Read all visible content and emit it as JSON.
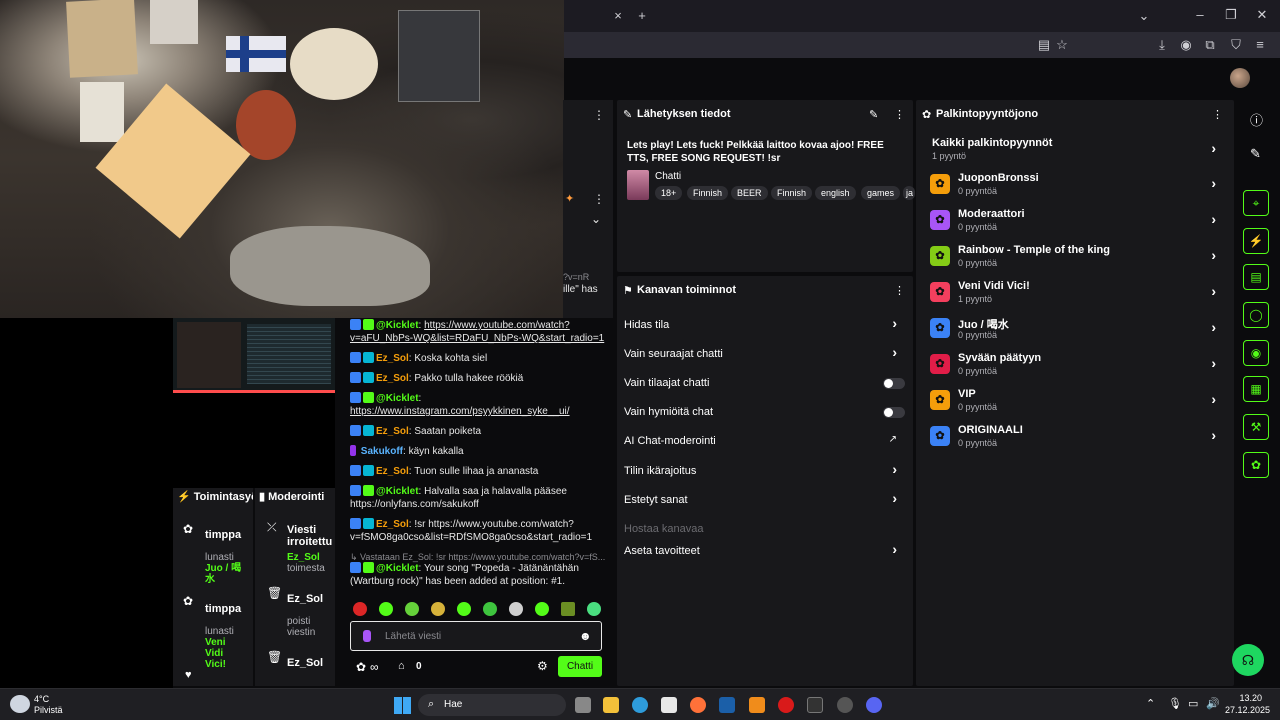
{
  "browser": {
    "tab_close": "×",
    "tab_new": "+"
  },
  "broadcast": {
    "header": "Lähetyksen tiedot",
    "title": "Lets play! Lets fuck! Pelkkää laittoo kovaa ajoo! FREE TTS, FREE SONG REQUEST! !sr",
    "category": "Chatti",
    "tags": [
      "18+",
      "Finnish",
      "BEER",
      "Finnish",
      "english",
      "games",
      "ja"
    ]
  },
  "channel_actions": {
    "header": "Kanavan toiminnot",
    "items": [
      {
        "label": "Hidas tila",
        "control": "chevron"
      },
      {
        "label": "Vain seuraajat chatti",
        "control": "chevron"
      },
      {
        "label": "Vain tilaajat chatti",
        "control": "toggle"
      },
      {
        "label": "Vain hymiöitä chat",
        "control": "toggle"
      },
      {
        "label": "AI Chat-moderointi",
        "control": "external"
      },
      {
        "label": "Tilin ikärajoitus",
        "control": "chevron"
      },
      {
        "label": "Estetyt sanat",
        "control": "chevron"
      },
      {
        "label": "Hostaa kanavaa",
        "control": "none"
      },
      {
        "label": "Aseta tavoitteet",
        "control": "chevron"
      }
    ]
  },
  "rewards": {
    "header": "Palkintopyyntöjono",
    "all_label": "Kaikki palkintopyynnöt",
    "all_count": "1 pyyntö",
    "items": [
      {
        "title": "JuoponBronssi",
        "count": "0 pyyntöä",
        "color": "#f59e0b"
      },
      {
        "title": "Moderaattori",
        "count": "0 pyyntöä",
        "color": "#a855f7"
      },
      {
        "title": "Rainbow - Temple of the king",
        "count": "0 pyyntöä",
        "color": "#84cc16"
      },
      {
        "title": "Veni Vidi Vici!",
        "count": "1 pyyntö",
        "color": "#f43f5e"
      },
      {
        "title": "Juo / 喝水",
        "count": "0 pyyntöä",
        "color": "#3b82f6"
      },
      {
        "title": "Syvään päätyyn",
        "count": "0 pyyntöä",
        "color": "#e11d48"
      },
      {
        "title": "VIP",
        "count": "0 pyyntöä",
        "color": "#f59e0b"
      },
      {
        "title": "ORIGINAALI",
        "count": "0 pyyntöä",
        "color": "#3b82f6"
      }
    ]
  },
  "activity": {
    "header": "Toimintasyöt",
    "items": [
      {
        "user": "timppa",
        "action": "lunasti",
        "reward": "Juo / 喝水"
      },
      {
        "user": "timppa",
        "action": "lunasti",
        "reward": "Veni Vidi Vici!"
      }
    ]
  },
  "moderation": {
    "header": "Moderointi",
    "items": [
      {
        "title": "Viesti irroitettu",
        "user": "Ez_Sol",
        "action": "toimesta"
      },
      {
        "title": "Ez_Sol",
        "action": "poisti viestin"
      },
      {
        "title": "Ez_Sol",
        "action": ""
      }
    ]
  },
  "chat": {
    "partial_1": "?v=nR",
    "partial_2": "ille\" has",
    "messages": [
      {
        "user": "@Kicklet",
        "type": "bot",
        "text": "https://www.youtube.com/watch?v=aFU_NbPs-WQ&list=RDaFU_NbPs-WQ&start_radio=1",
        "link": true
      },
      {
        "user": "Ez_Sol",
        "type": "user",
        "text": "Koska kohta siel"
      },
      {
        "user": "Ez_Sol",
        "type": "user",
        "text": "Pakko tulla hakee röökiä"
      },
      {
        "user": "@Kicklet",
        "type": "bot",
        "text": "https://www.instagram.com/psyykkinen_syke__ui/",
        "link": true
      },
      {
        "user": "Ez_Sol",
        "type": "user",
        "text": "Saatan poiketa"
      },
      {
        "user": "Sakukoff",
        "type": "viewer",
        "text": "käyn kakalla"
      },
      {
        "user": "Ez_Sol",
        "type": "user",
        "text": "Tuon sulle lihaa ja ananasta"
      },
      {
        "user": "@Kicklet",
        "type": "bot",
        "text": "Halvalla saa ja halavalla pääsee https://onlyfans.com/sakukoff",
        "link": false
      },
      {
        "user": "Ez_Sol",
        "type": "user",
        "text": "!sr https://www.youtube.com/watch?v=fSMO8ga0cso&list=RDfSMO8ga0cso&start_radio=1",
        "link": false
      }
    ],
    "reply_preview": "Vastataan Ez_Sol: !sr https://www.youtube.com/watch?v=fS...",
    "last_message_user": "@Kicklet",
    "last_message_text": "Your song \"Popeda - Jätänäntähän (Wartburg rock)\" has been added at position: #1.",
    "input_placeholder": "Lähetä viesti",
    "count_1": "∞",
    "count_2": "0",
    "send_label": "Chatti"
  },
  "taskbar": {
    "weather_temp": "4°C",
    "weather_desc": "Pilvistä",
    "search_label": "Hae",
    "time": "13.20",
    "date": "27.12.2025"
  }
}
